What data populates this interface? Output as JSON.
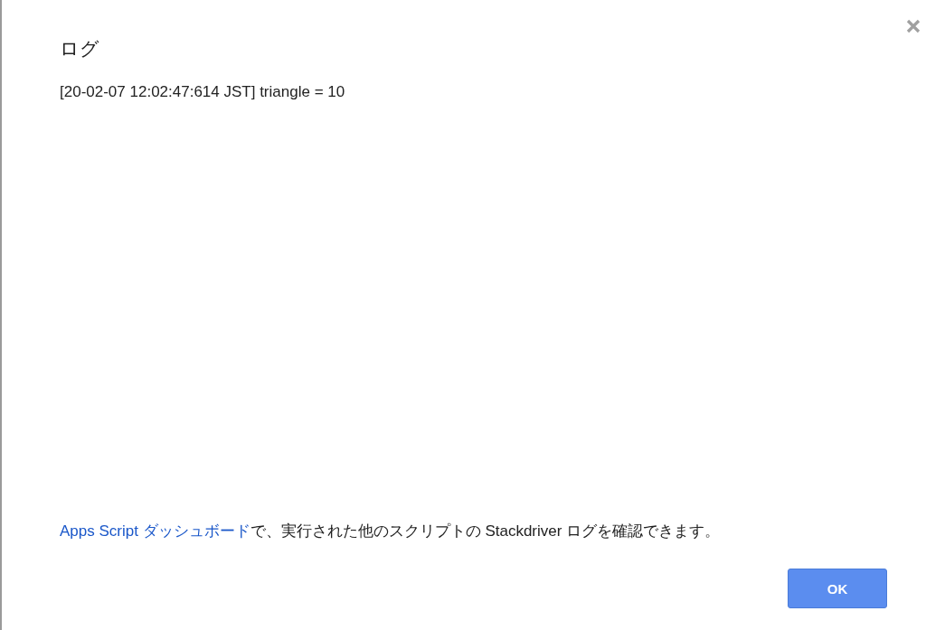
{
  "dialog": {
    "title": "ログ",
    "log_lines": [
      "[20-02-07 12:02:47:614 JST] triangle = 10"
    ],
    "footer": {
      "link": "Apps Script ダッシュボード",
      "text": "で、実行された他のスクリプトの Stackdriver ログを確認できます。"
    },
    "buttons": [
      "OK"
    ]
  }
}
